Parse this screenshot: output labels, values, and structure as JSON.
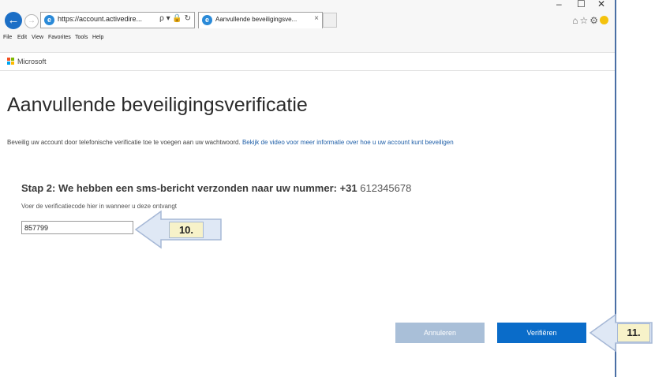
{
  "browser": {
    "url": "https://account.activedire...",
    "url_controls": "ρ ▾ 🔒 ↻",
    "tab_title": "Aanvullende beveiligingsve...",
    "tab_close": "×",
    "window_controls": {
      "minimize": "–",
      "maximize": "☐",
      "close": "✕"
    },
    "menu": [
      "File",
      "Edit",
      "View",
      "Favorites",
      "Tools",
      "Help"
    ]
  },
  "brand": {
    "name": "Microsoft",
    "colors": [
      "#f25022",
      "#7fba00",
      "#00a4ef",
      "#ffb900"
    ]
  },
  "page": {
    "title": "Aanvullende beveiligingsverificatie",
    "description": "Beveilig uw account door telefonische verificatie toe te voegen aan uw wachtwoord.",
    "description_link": "Bekijk de video voor meer informatie over hoe u uw account kunt beveiligen",
    "step_text": "Stap 2: We hebben een sms-bericht verzonden naar uw nummer: +31 ",
    "phone_number": "612345678",
    "hint": "Voer de verificatiecode hier in wanneer u deze ontvangt",
    "code_value": "857799",
    "cancel_label": "Annuleren",
    "verify_label": "Verifiëren"
  },
  "callouts": {
    "first": "10.",
    "second": "11."
  },
  "colors": {
    "accent": "#0a6cc9",
    "disabled": "#a9bfd8",
    "callout_fill": "#f7f2c9"
  }
}
